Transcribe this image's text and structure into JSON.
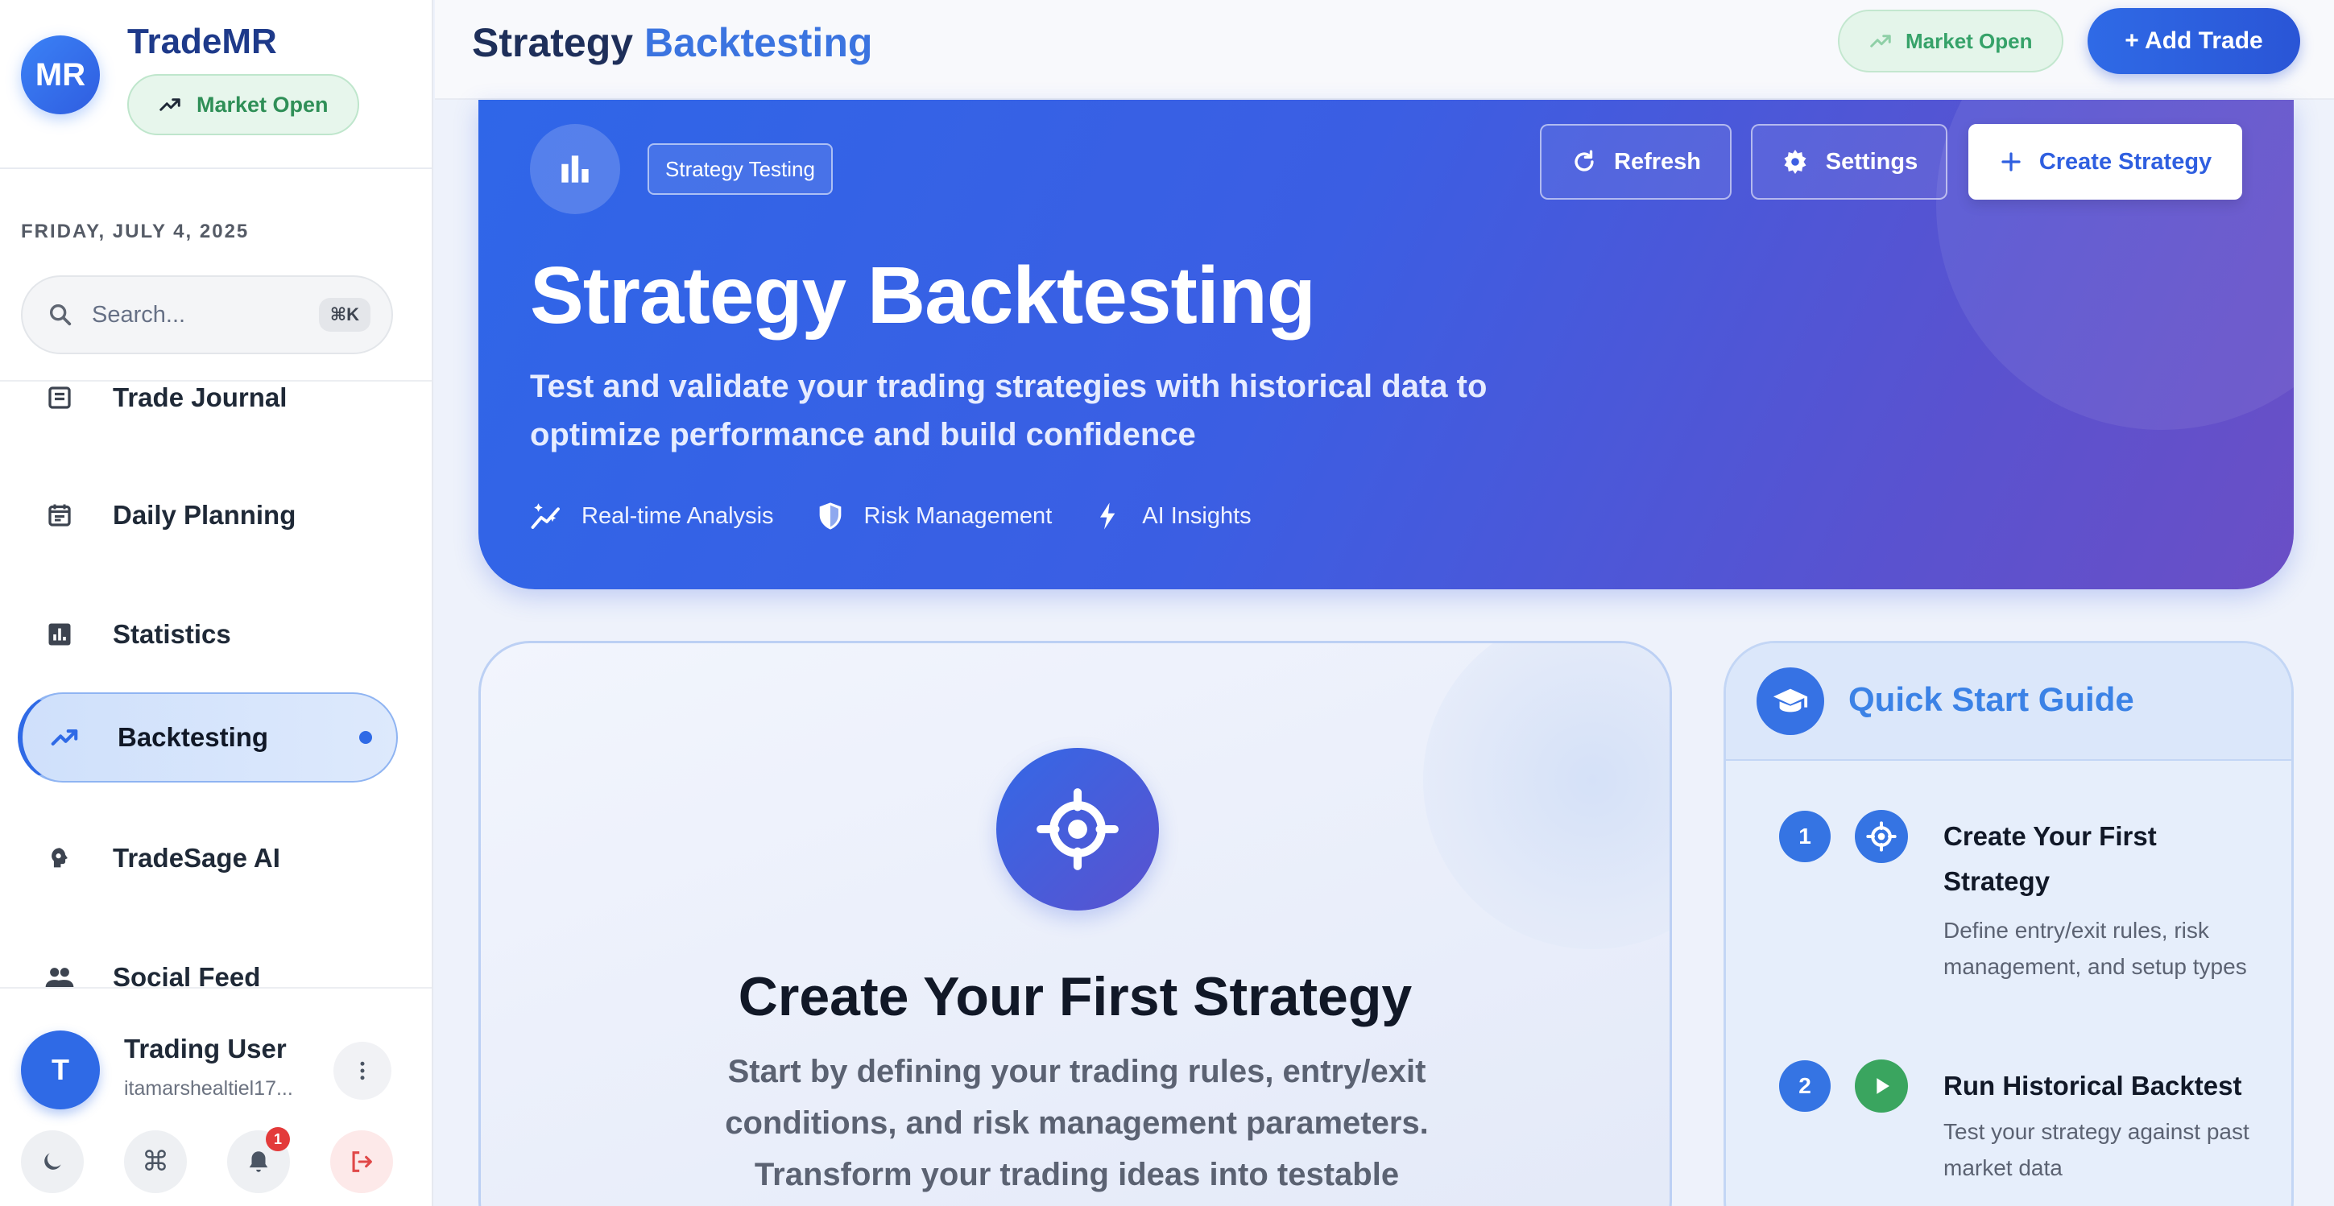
{
  "app": {
    "brand_initials": "MR",
    "brand_name": "TradeMR",
    "market_status": "Market Open"
  },
  "sidebar": {
    "date": "FRIDAY, JULY 4, 2025",
    "search": {
      "placeholder": "Search...",
      "shortcut": "⌘K"
    },
    "items": [
      {
        "label": "Trade Journal",
        "icon": "journal-icon",
        "active": false
      },
      {
        "label": "Daily Planning",
        "icon": "calendar-icon",
        "active": false
      },
      {
        "label": "Statistics",
        "icon": "bar-chart-icon",
        "active": false
      },
      {
        "label": "Backtesting",
        "icon": "trending-up-icon",
        "active": true
      },
      {
        "label": "TradeSage AI",
        "icon": "ai-brain-icon",
        "active": false
      },
      {
        "label": "Social Feed",
        "icon": "people-icon",
        "active": false
      }
    ],
    "user": {
      "initial": "T",
      "name": "Trading User",
      "email": "itamarshealtiel17..."
    },
    "notifications_count": "1"
  },
  "header": {
    "title_primary": "Strategy",
    "title_accent": "Backtesting",
    "market_status": "Market Open",
    "add_trade_label": "+ Add Trade"
  },
  "hero": {
    "tag": "Strategy Testing",
    "refresh_label": "Refresh",
    "settings_label": "Settings",
    "create_label": "Create Strategy",
    "title": "Strategy Backtesting",
    "subtitle": "Test and validate your trading strategies with historical data to optimize performance and build confidence",
    "features": [
      {
        "label": "Real-time Analysis",
        "icon": "sparkle-chart-icon"
      },
      {
        "label": "Risk Management",
        "icon": "shield-icon"
      },
      {
        "label": "AI Insights",
        "icon": "bolt-icon"
      }
    ]
  },
  "main_card": {
    "title": "Create Your First Strategy",
    "description": "Start by defining your trading rules, entry/exit conditions, and risk management parameters. Transform your trading ideas into testable"
  },
  "guide": {
    "title": "Quick Start Guide",
    "steps": [
      {
        "number": "1",
        "title": "Create Your First Strategy",
        "description": "Define entry/exit rules, risk management, and setup types",
        "icon": "target-icon"
      },
      {
        "number": "2",
        "title": "Run Historical Backtest",
        "description": "Test your strategy against past market data",
        "icon": "play-icon"
      }
    ]
  },
  "colors": {
    "primary": "#2f6ae6",
    "hero_start": "#2f66e8",
    "hero_end": "#6a4fc6",
    "market_green": "#2f8f57",
    "step_play_green": "#3aa55f"
  }
}
